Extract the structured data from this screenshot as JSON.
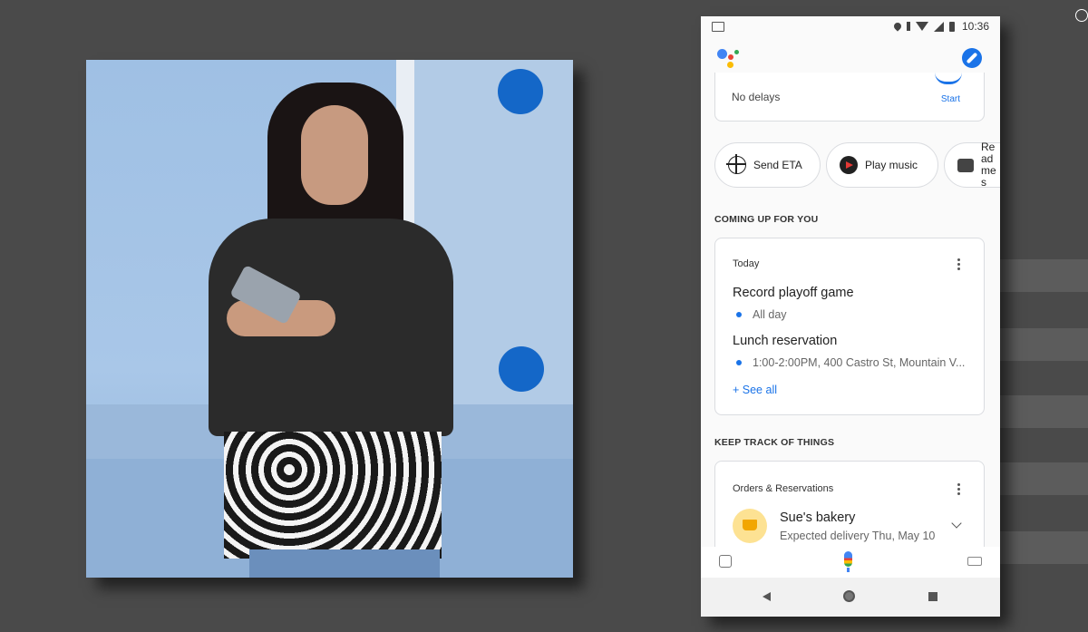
{
  "status_bar": {
    "time": "10:36"
  },
  "commute_card": {
    "status": "No delays",
    "action": "Start"
  },
  "chips": [
    {
      "label": "Send ETA",
      "icon": "crosshair-icon"
    },
    {
      "label": "Play music",
      "icon": "music-play-icon"
    },
    {
      "label": "Read mes",
      "icon": "message-icon"
    }
  ],
  "coming_up": {
    "section_title": "COMING UP FOR YOU",
    "day": "Today",
    "events": [
      {
        "title": "Record playoff game",
        "detail": "All day"
      },
      {
        "title": "Lunch reservation",
        "detail": "1:00-2:00PM, 400 Castro St, Mountain V..."
      }
    ],
    "see_all": "+ See all"
  },
  "keep_track": {
    "section_title": "KEEP TRACK OF THINGS",
    "card_title": "Orders & Reservations",
    "item_title": "Sue's bakery",
    "item_detail": "Expected delivery Thu, May 10"
  },
  "colors": {
    "accent": "#1a73e8",
    "dot_blue": "#1467c8",
    "background": "#4a4a4a",
    "cart_circle": "#fde293"
  }
}
